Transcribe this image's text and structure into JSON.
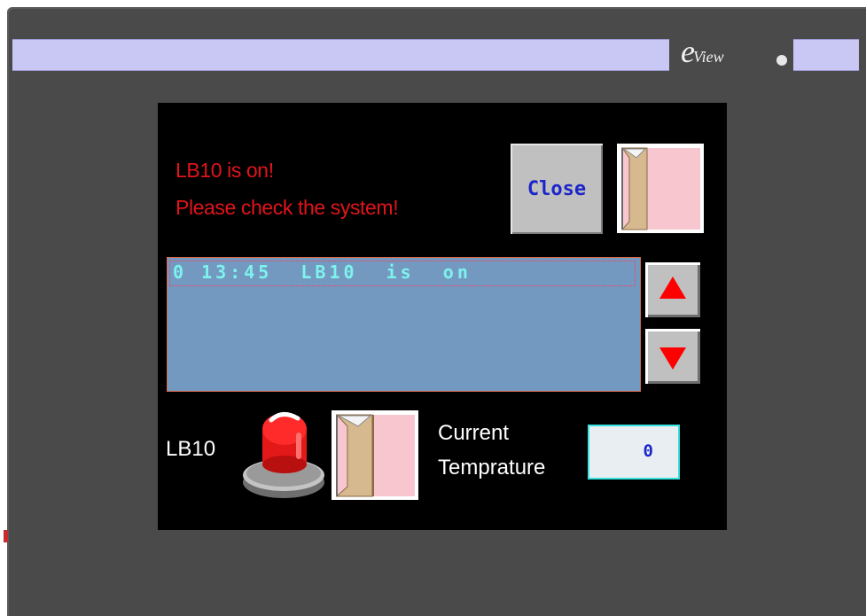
{
  "device": {
    "brand_mark": "e",
    "brand_name": "View"
  },
  "alarm_message": {
    "line1": "LB10 is on!",
    "line2": "Please check the system!"
  },
  "close_button": {
    "label": "Close"
  },
  "alarm_list": {
    "entries": [
      {
        "text": "0 13:45  LB10  is  on"
      }
    ]
  },
  "lamp": {
    "label": "LB10",
    "state": "on"
  },
  "temperature": {
    "label_line1": "Current",
    "label_line2": "Temprature",
    "value": "0"
  },
  "colors": {
    "bezel": "#4a4a4a",
    "brand_bar": "#c9c7f3",
    "screen": "#000000",
    "alarm_text": "#e1141b",
    "list_background": "#7399c0",
    "list_text": "#7ef2ec",
    "button_text": "#1b26c9",
    "window_pink": "#f7c6cf",
    "window_frame": "#d6b98e",
    "arrow_red": "#ff0000"
  },
  "icons": {
    "window_button": "window-door-icon",
    "scroll_up": "triangle-up-icon",
    "scroll_down": "triangle-down-icon",
    "lamp": "red-lamp-icon"
  }
}
